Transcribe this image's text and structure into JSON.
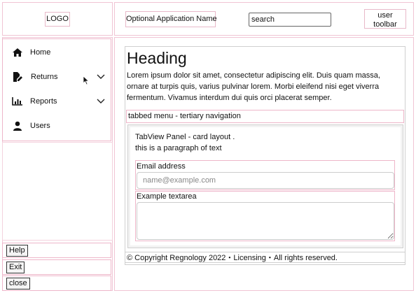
{
  "header": {
    "logo": "LOGO",
    "app_name": "Optional Application Name",
    "search_value": "search",
    "user_toolbar": "user toolbar"
  },
  "sidebar": {
    "items": [
      {
        "label": "Home",
        "icon": "home-icon",
        "has_chevron": false
      },
      {
        "label": "Returns",
        "icon": "file-edit-icon",
        "has_chevron": true
      },
      {
        "label": "Reports",
        "icon": "bar-chart-icon",
        "has_chevron": true
      },
      {
        "label": "Users",
        "icon": "user-icon",
        "has_chevron": false
      }
    ],
    "bottom_buttons": [
      {
        "label": "Help"
      },
      {
        "label": "Exit"
      },
      {
        "label": "close"
      }
    ]
  },
  "main": {
    "heading": "Heading",
    "paragraph": "Lorem ipsum dolor sit amet, consectetur adipiscing elit. Duis quam massa, ornare at turpis quis, varius pulvinar lorem. Morbi eleifend nisi eget viverra fermentum. Vivamus interdum dui quis orci placerat semper.",
    "tabbed_menu": "tabbed menu - tertiary navigation",
    "tab_panel": {
      "line1": "TabView Panel - card layout .",
      "line2": "this is a paragraph of text"
    },
    "form": {
      "email_label": "Email address",
      "email_placeholder": "name@example.com",
      "textarea_label": "Example textarea"
    },
    "footer": "© Copyright Regnology 2022・Licensing・All rights reserved."
  },
  "colors": {
    "outline_pink": "#eeb6c9",
    "panel_border": "#cfcfcf"
  }
}
